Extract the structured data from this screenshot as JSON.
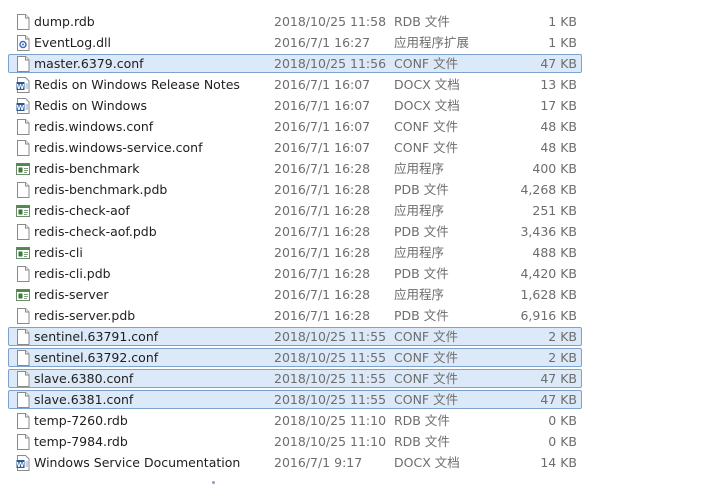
{
  "files": [
    {
      "name": "dump.rdb",
      "date": "2018/10/25 11:58",
      "type": "RDB 文件",
      "size": "1 KB",
      "icon": "blank-file-icon",
      "selected": false
    },
    {
      "name": "EventLog.dll",
      "date": "2016/7/1 16:27",
      "type": "应用程序扩展",
      "size": "1 KB",
      "icon": "dll-file-icon",
      "selected": false
    },
    {
      "name": "master.6379.conf",
      "date": "2018/10/25 11:56",
      "type": "CONF 文件",
      "size": "47 KB",
      "icon": "blank-file-icon",
      "selected": true
    },
    {
      "name": "Redis on Windows Release Notes",
      "date": "2016/7/1 16:07",
      "type": "DOCX 文档",
      "size": "13 KB",
      "icon": "docx-file-icon",
      "selected": false
    },
    {
      "name": "Redis on Windows",
      "date": "2016/7/1 16:07",
      "type": "DOCX 文档",
      "size": "17 KB",
      "icon": "docx-file-icon",
      "selected": false
    },
    {
      "name": "redis.windows.conf",
      "date": "2016/7/1 16:07",
      "type": "CONF 文件",
      "size": "48 KB",
      "icon": "blank-file-icon",
      "selected": false
    },
    {
      "name": "redis.windows-service.conf",
      "date": "2016/7/1 16:07",
      "type": "CONF 文件",
      "size": "48 KB",
      "icon": "blank-file-icon",
      "selected": false
    },
    {
      "name": "redis-benchmark",
      "date": "2016/7/1 16:28",
      "type": "应用程序",
      "size": "400 KB",
      "icon": "exe-file-icon",
      "selected": false
    },
    {
      "name": "redis-benchmark.pdb",
      "date": "2016/7/1 16:28",
      "type": "PDB 文件",
      "size": "4,268 KB",
      "icon": "blank-file-icon",
      "selected": false
    },
    {
      "name": "redis-check-aof",
      "date": "2016/7/1 16:28",
      "type": "应用程序",
      "size": "251 KB",
      "icon": "exe-file-icon",
      "selected": false
    },
    {
      "name": "redis-check-aof.pdb",
      "date": "2016/7/1 16:28",
      "type": "PDB 文件",
      "size": "3,436 KB",
      "icon": "blank-file-icon",
      "selected": false
    },
    {
      "name": "redis-cli",
      "date": "2016/7/1 16:28",
      "type": "应用程序",
      "size": "488 KB",
      "icon": "exe-file-icon",
      "selected": false
    },
    {
      "name": "redis-cli.pdb",
      "date": "2016/7/1 16:28",
      "type": "PDB 文件",
      "size": "4,420 KB",
      "icon": "blank-file-icon",
      "selected": false
    },
    {
      "name": "redis-server",
      "date": "2016/7/1 16:28",
      "type": "应用程序",
      "size": "1,628 KB",
      "icon": "exe-file-icon",
      "selected": false
    },
    {
      "name": "redis-server.pdb",
      "date": "2016/7/1 16:28",
      "type": "PDB 文件",
      "size": "6,916 KB",
      "icon": "blank-file-icon",
      "selected": false
    },
    {
      "name": "sentinel.63791.conf",
      "date": "2018/10/25 11:55",
      "type": "CONF 文件",
      "size": "2 KB",
      "icon": "blank-file-icon",
      "selected": true
    },
    {
      "name": "sentinel.63792.conf",
      "date": "2018/10/25 11:55",
      "type": "CONF 文件",
      "size": "2 KB",
      "icon": "blank-file-icon",
      "selected": true
    },
    {
      "name": "slave.6380.conf",
      "date": "2018/10/25 11:55",
      "type": "CONF 文件",
      "size": "47 KB",
      "icon": "blank-file-icon",
      "selected": true
    },
    {
      "name": "slave.6381.conf",
      "date": "2018/10/25 11:55",
      "type": "CONF 文件",
      "size": "47 KB",
      "icon": "blank-file-icon",
      "selected": true
    },
    {
      "name": "temp-7260.rdb",
      "date": "2018/10/25 11:10",
      "type": "RDB 文件",
      "size": "0 KB",
      "icon": "blank-file-icon",
      "selected": false
    },
    {
      "name": "temp-7984.rdb",
      "date": "2018/10/25 11:10",
      "type": "RDB 文件",
      "size": "0 KB",
      "icon": "blank-file-icon",
      "selected": false
    },
    {
      "name": "Windows Service Documentation",
      "date": "2016/7/1 9:17",
      "type": "DOCX 文档",
      "size": "14 KB",
      "icon": "docx-file-icon",
      "selected": false
    }
  ],
  "colors": {
    "selection_fill": "#dce9f8",
    "selection_border": "#7da2ce",
    "secondary_text": "#6d6d6d"
  }
}
